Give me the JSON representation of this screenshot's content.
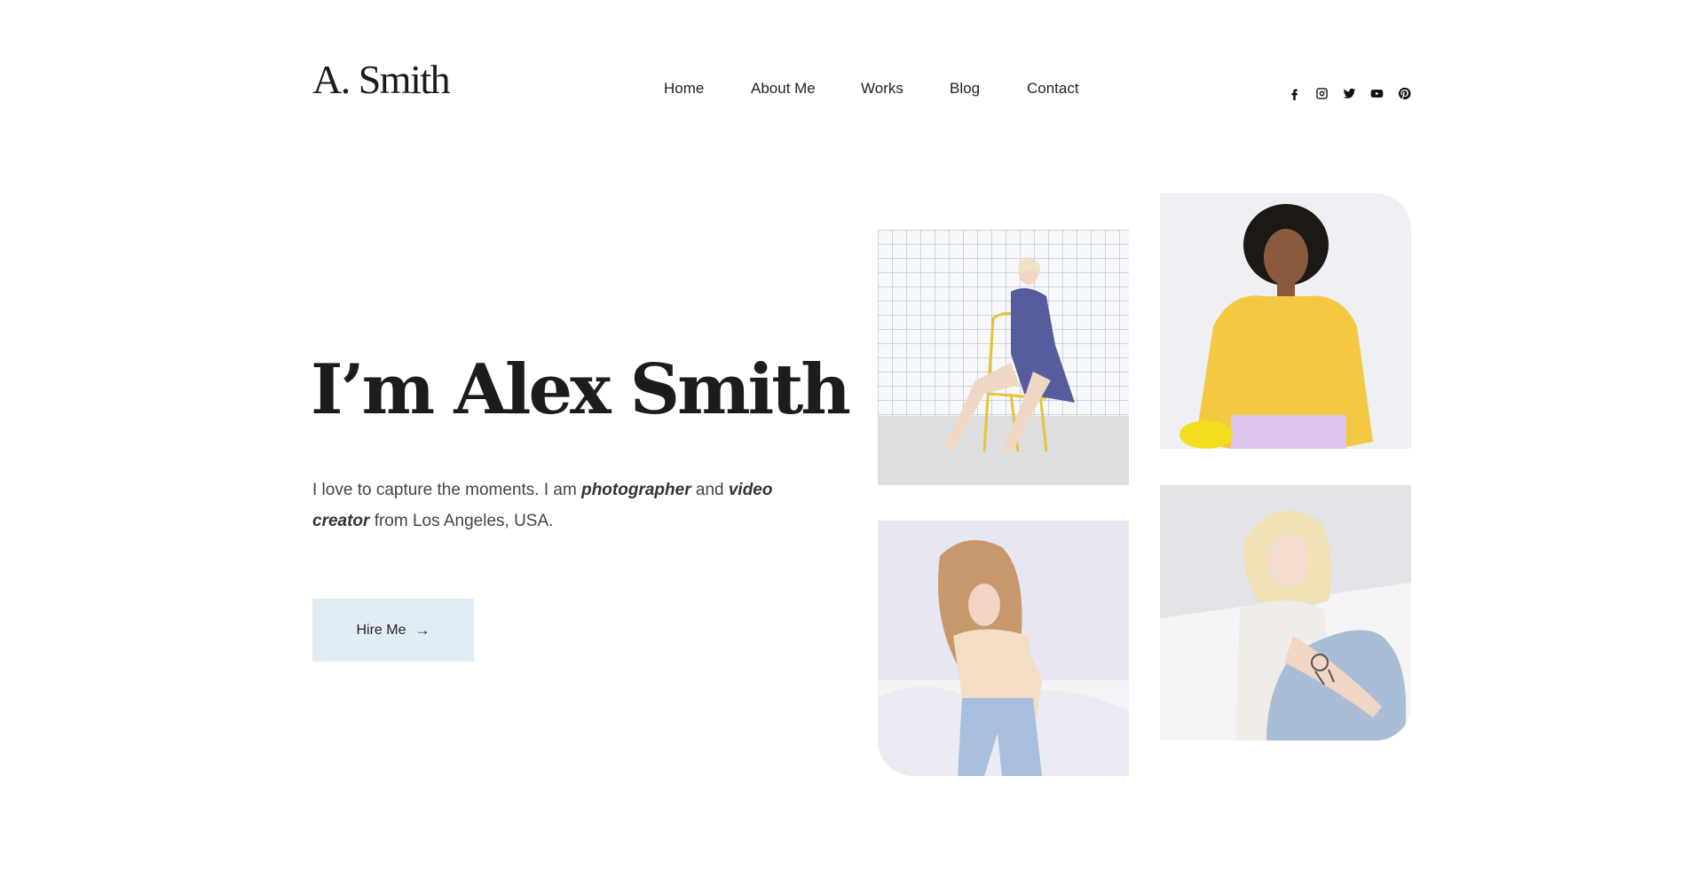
{
  "brand": {
    "logo_text": "A. Smith"
  },
  "nav": {
    "items": [
      {
        "label": "Home"
      },
      {
        "label": "About Me"
      },
      {
        "label": "Works"
      },
      {
        "label": "Blog"
      },
      {
        "label": "Contact"
      }
    ]
  },
  "social": {
    "icons": [
      "facebook-icon",
      "instagram-icon",
      "twitter-icon",
      "youtube-icon",
      "pinterest-icon"
    ]
  },
  "hero": {
    "title": "I’m Alex Smith",
    "desc_part1": "I love to capture the moments. I am ",
    "desc_em1": "photographer",
    "desc_part2": " and ",
    "desc_em2": "video creator",
    "desc_part3": " from Los Angeles, USA.",
    "button_label": "Hire Me",
    "button_icon": "arrow-right-icon",
    "button_color": "#e1edf5"
  },
  "gallery": {
    "photos": [
      {
        "subject": "woman-seated-on-yellow-chair"
      },
      {
        "subject": "woman-in-yellow-sweater"
      },
      {
        "subject": "woman-on-bed-touching-hair"
      },
      {
        "subject": "woman-with-tattoo-sitting"
      }
    ]
  }
}
